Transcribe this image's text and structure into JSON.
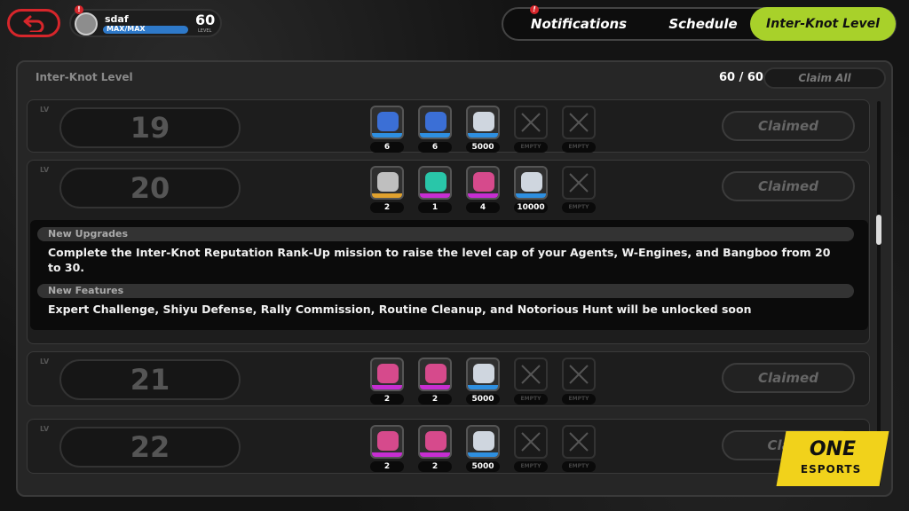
{
  "header": {
    "username": "sdaf",
    "rank": "MAX/MAX",
    "level": "60",
    "level_label": "LEVEL",
    "profile_alert": "!"
  },
  "tabs": [
    {
      "label": "Notifications",
      "badge": "!"
    },
    {
      "label": "Schedule"
    },
    {
      "label": "Inter-Knot Level",
      "active": true
    }
  ],
  "panel": {
    "title": "Inter-Knot Level",
    "progress": "60 / 60",
    "claim_all": "Claim All"
  },
  "colors": {
    "accent": "#a8d12a",
    "alert": "#d6262b",
    "rarity_blue": "#2e8fe0",
    "rarity_gold": "#e0a12e",
    "rarity_purple": "#c62ed1"
  },
  "empty_label": "EMPTY",
  "levels": [
    {
      "level": "19",
      "status": "Claimed",
      "rewards": [
        {
          "icon": "blue-item-icon",
          "qty": "6",
          "rarity": "blue"
        },
        {
          "icon": "blue-item-icon",
          "qty": "6",
          "rarity": "blue"
        },
        {
          "icon": "dennies-icon",
          "qty": "5000",
          "rarity": "blue"
        },
        {
          "empty": true
        },
        {
          "empty": true
        }
      ]
    },
    {
      "level": "20",
      "status": "Claimed",
      "rewards": [
        {
          "icon": "gold-item-icon",
          "qty": "2",
          "rarity": "gold"
        },
        {
          "icon": "ticket-icon",
          "qty": "1",
          "rarity": "purple"
        },
        {
          "icon": "purple-item-icon",
          "qty": "4",
          "rarity": "purple"
        },
        {
          "icon": "dennies-icon",
          "qty": "10000",
          "rarity": "blue"
        },
        {
          "empty": true
        }
      ],
      "info": {
        "sections": [
          {
            "heading": "New Upgrades",
            "text": "Complete the Inter-Knot Reputation Rank-Up mission to raise the level cap of your Agents, W-Engines, and Bangboo from 20 to 30."
          },
          {
            "heading": "New Features",
            "text": "Expert Challenge, Shiyu Defense, Rally Commission, Routine Cleanup, and Notorious Hunt will be unlocked soon"
          }
        ]
      }
    },
    {
      "level": "21",
      "status": "Claimed",
      "rewards": [
        {
          "icon": "purple-item-icon",
          "qty": "2",
          "rarity": "purple"
        },
        {
          "icon": "purple-item-icon",
          "qty": "2",
          "rarity": "purple"
        },
        {
          "icon": "dennies-icon",
          "qty": "5000",
          "rarity": "blue"
        },
        {
          "empty": true
        },
        {
          "empty": true
        }
      ]
    },
    {
      "level": "22",
      "status": "Claim",
      "rewards": [
        {
          "icon": "purple-item-icon",
          "qty": "2",
          "rarity": "purple"
        },
        {
          "icon": "purple-item-icon",
          "qty": "2",
          "rarity": "purple"
        },
        {
          "icon": "dennies-icon",
          "qty": "5000",
          "rarity": "blue"
        },
        {
          "empty": true
        },
        {
          "empty": true
        }
      ]
    }
  ],
  "watermark": {
    "line1": "ONE",
    "line2": "ESPORTS"
  }
}
